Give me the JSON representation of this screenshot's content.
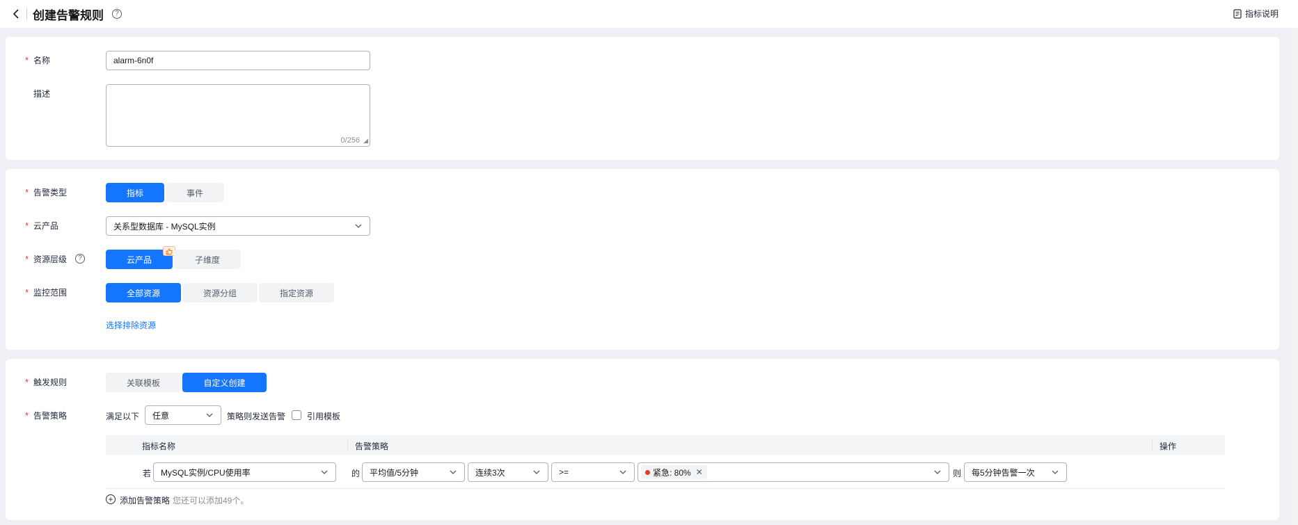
{
  "header": {
    "title": "创建告警规则",
    "help": "?",
    "metric_doc": "指标说明"
  },
  "basic": {
    "name_label": "名称",
    "name_value": "alarm-6n0f",
    "desc_label": "描述",
    "desc_value": "",
    "desc_counter": "0/256"
  },
  "target": {
    "alarm_type_label": "告警类型",
    "alarm_type_options": [
      "指标",
      "事件"
    ],
    "alarm_type_selected": "指标",
    "product_label": "云产品",
    "product_value": "关系型数据库 - MySQL实例",
    "level_label": "资源层级",
    "level_options": [
      "云产品",
      "子维度"
    ],
    "scope_label": "监控范围",
    "scope_options": [
      "全部资源",
      "资源分组",
      "指定资源"
    ],
    "exclude_link": "选择排除资源"
  },
  "trigger": {
    "rule_label": "触发规则",
    "rule_options": [
      "关联模板",
      "自定义创建"
    ],
    "policy_label": "告警策略",
    "satisfy_prefix": "满足以下",
    "satisfy_value": "任意",
    "satisfy_suffix": "策略则发送告警",
    "use_template": "引用模板",
    "table_headers": [
      "指标名称",
      "告警策略",
      "操作"
    ],
    "row": {
      "if": "若",
      "metric": "MySQL实例/CPU使用率",
      "of": "的",
      "aggregation": "平均值/5分钟",
      "consecutive": "连续3次",
      "operator": ">=",
      "threshold_tag": "紧急: 80%",
      "then": "则",
      "frequency": "每5分钟告警一次"
    },
    "add_policy": "添加告警策略",
    "add_hint": "您还可以添加49个。"
  },
  "colors": {
    "primary": "#1476ff",
    "required": "#e5382e"
  }
}
